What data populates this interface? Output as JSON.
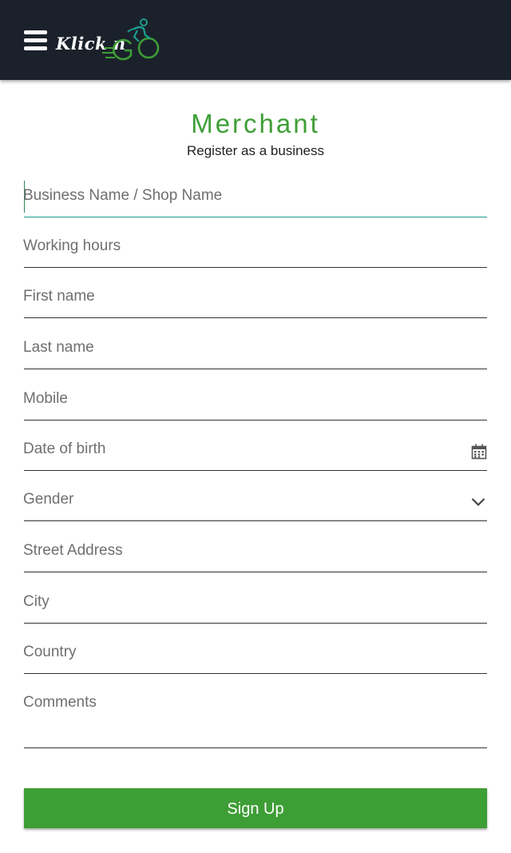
{
  "header": {
    "logo_text": "Klick n",
    "logo_mark": "GO",
    "menu_icon": "hamburger-menu-icon",
    "background_color": "#1b212b"
  },
  "page": {
    "title": "Merchant",
    "subtitle": "Register as a business",
    "accent_color": "#3e9e36"
  },
  "form": {
    "business_name": {
      "placeholder": "Business Name / Shop Name",
      "value": ""
    },
    "working_hours": {
      "placeholder": "Working hours",
      "value": ""
    },
    "first_name": {
      "placeholder": "First name",
      "value": ""
    },
    "last_name": {
      "placeholder": "Last name",
      "value": ""
    },
    "mobile": {
      "placeholder": "Mobile",
      "value": ""
    },
    "date_of_birth": {
      "placeholder": "Date of birth",
      "value": "",
      "icon": "calendar-icon"
    },
    "gender": {
      "placeholder": "Gender",
      "value": "",
      "icon": "chevron-down-icon"
    },
    "street_address": {
      "placeholder": "Street Address",
      "value": ""
    },
    "city": {
      "placeholder": "City",
      "value": ""
    },
    "country": {
      "placeholder": "Country",
      "value": ""
    },
    "comments": {
      "placeholder": "Comments",
      "value": ""
    }
  },
  "actions": {
    "signup_label": "Sign Up"
  }
}
